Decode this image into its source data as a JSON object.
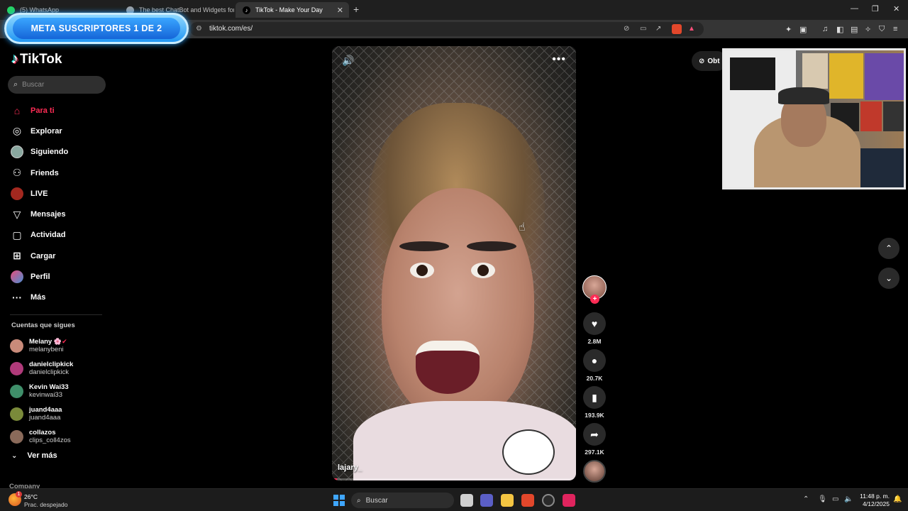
{
  "browser": {
    "tabs": [
      {
        "label": "(5) WhatsApp",
        "color": "#25d366"
      },
      {
        "label": "The best ChatBot and Widgets for Ki",
        "color": "#9aa0a6"
      },
      {
        "label": "TikTok - Make Your Day",
        "color": "#ffffff",
        "active": true
      }
    ],
    "url": "tiktok.com/es/",
    "banner": "META SUSCRIPTORES 1 DE 2"
  },
  "sidebar": {
    "logo": "TikTok",
    "search_placeholder": "Buscar",
    "nav": [
      {
        "label": "Para ti",
        "icon": "home-icon",
        "active": true
      },
      {
        "label": "Explorar",
        "icon": "compass-icon"
      },
      {
        "label": "Siguiendo",
        "icon": "following-avatar-icon"
      },
      {
        "label": "Friends",
        "icon": "friends-icon"
      },
      {
        "label": "LIVE",
        "icon": "live-icon"
      },
      {
        "label": "Mensajes",
        "icon": "send-icon"
      },
      {
        "label": "Actividad",
        "icon": "activity-icon"
      },
      {
        "label": "Cargar",
        "icon": "upload-icon"
      },
      {
        "label": "Perfil",
        "icon": "profile-avatar-icon"
      },
      {
        "label": "Más",
        "icon": "more-dots-icon"
      }
    ],
    "following_title": "Cuentas que sigues",
    "accounts": [
      {
        "name": "Melany",
        "username": "melanybeni",
        "avatar_color": "#c98b7a",
        "badges": "🌸✔"
      },
      {
        "name": "danielclipkick",
        "username": "danielclipkick",
        "avatar_color": "#b03a7a",
        "badges": ""
      },
      {
        "name": "Kevin Wai33",
        "username": "kevinwai33",
        "avatar_color": "#3f8f6a",
        "badges": ""
      },
      {
        "name": "juand4aaa",
        "username": "juand4aaa",
        "avatar_color": "#7a8a3a",
        "badges": ""
      },
      {
        "name": "collazos",
        "username": "clips_coll4zos",
        "avatar_color": "#8a6a5a",
        "badges": ""
      }
    ],
    "see_more": "Ver más",
    "company": "Company"
  },
  "video": {
    "username": "lajary_",
    "progress": 0.02
  },
  "actions": {
    "likes": "2.8M",
    "comments": "20.7K",
    "saves": "193.9K",
    "shares": "297.1K"
  },
  "get_app": "Obt",
  "taskbar": {
    "temperature": "26°C",
    "weather": "Prac. despejado",
    "weather_badge": "1",
    "search": "Buscar",
    "time": "11:48 p. m.",
    "date": "4/12/2025"
  }
}
